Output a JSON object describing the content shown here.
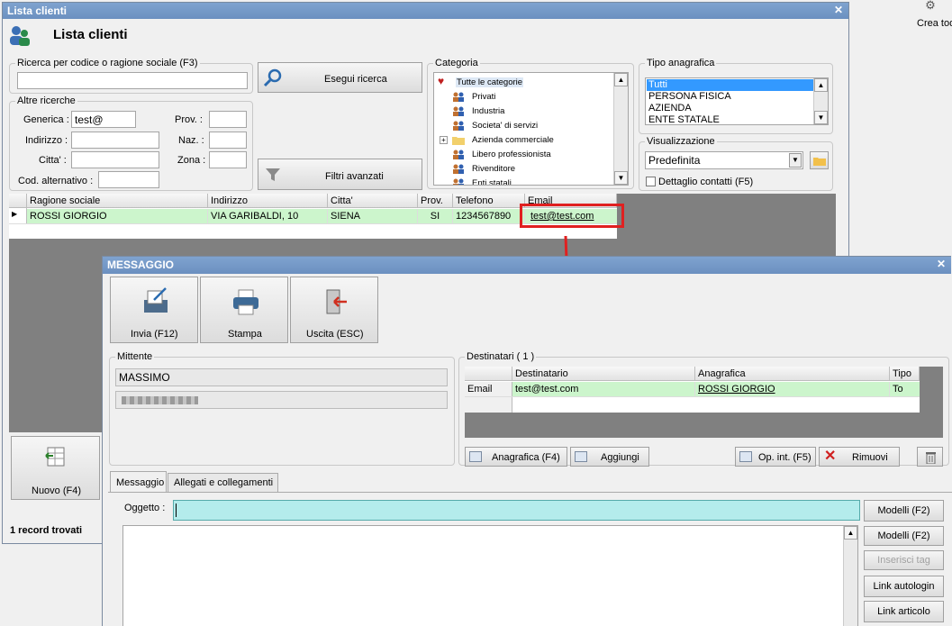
{
  "crea_label": "Crea tod",
  "clienti": {
    "title": "Lista clienti",
    "heading": "Lista clienti",
    "ricerca_legend": "Ricerca per codice o ragione sociale (F3)",
    "esegui_label": "Esegui ricerca",
    "altre_legend": "Altre ricerche",
    "generica_label": "Generica :",
    "generica_value": "test@",
    "indirizzo_label": "Indirizzo :",
    "citta_label": "Citta' :",
    "codalt_label": "Cod. alternativo :",
    "prov_label": "Prov. :",
    "naz_label": "Naz. :",
    "zona_label": "Zona :",
    "filtri_label": "Filtri avanzati",
    "categoria_legend": "Categoria",
    "categorie": [
      "Tutte le categorie",
      "Privati",
      "Industria",
      "Societa' di servizi",
      "Azienda commerciale",
      "Libero professionista",
      "Rivenditore",
      "Enti statali"
    ],
    "tipo_legend": "Tipo anagrafica",
    "tipi": [
      "Tutti",
      "PERSONA FISICA",
      "AZIENDA",
      "ENTE STATALE"
    ],
    "vis_legend": "Visualizzazione",
    "vis_value": "Predefinita",
    "dettaglio_label": "Dettaglio contatti (F5)",
    "columns": [
      "Ragione sociale",
      "Indirizzo",
      "Citta'",
      "Prov.",
      "Telefono",
      "Email"
    ],
    "row": [
      "ROSSI GIORGIO",
      "VIA GARIBALDI, 10",
      "SIENA",
      "SI",
      "1234567890",
      "test@test.com"
    ],
    "nuovo_label": "Nuovo (F4)",
    "status": "1 record trovati"
  },
  "messaggio": {
    "title": "MESSAGGIO",
    "invia_label": "Invia (F12)",
    "stampa_label": "Stampa",
    "uscita_label": "Uscita (ESC)",
    "mittente_legend": "Mittente",
    "mittente_name": "MASSIMO",
    "dest_legend": "Destinatari ( 1 )",
    "dest_columns": [
      "Destinatario",
      "Anagrafica",
      "Tipo"
    ],
    "dest_row": [
      "Email",
      "test@test.com",
      "ROSSI GIORGIO",
      "To"
    ],
    "anagrafica_btn": "Anagrafica (F4)",
    "aggiungi_btn": "Aggiungi",
    "opint_btn": "Op. int. (F5)",
    "rimuovi_btn": "Rimuovi",
    "tab_messaggio": "Messaggio",
    "tab_allegati": "Allegati e collegamenti",
    "oggetto_label": "Oggetto :",
    "modelli1": "Modelli (F2)",
    "modelli2": "Modelli (F2)",
    "inserisci_tag": "Inserisci tag",
    "link_autologin": "Link autologin",
    "link_articolo": "Link articolo"
  },
  "colors": {
    "highlight_box": "#e02020",
    "arrow": "#e02020",
    "selected_row": "#ccf5cc",
    "oggetto_bg": "#b4ecec",
    "title_bar": "#6b90c0"
  }
}
